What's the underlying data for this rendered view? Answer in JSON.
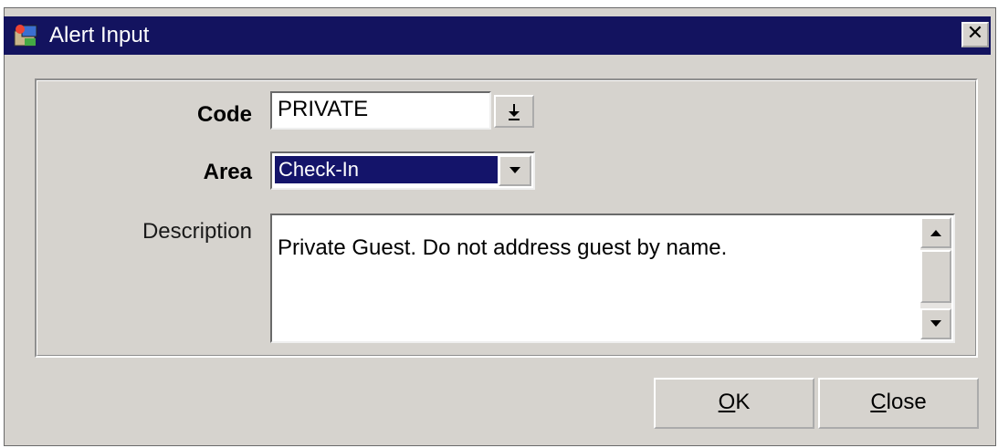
{
  "window": {
    "title": "Alert Input",
    "close_glyph": "✕",
    "icon": "app-icon"
  },
  "form": {
    "code": {
      "label": "Code",
      "value": "PRIVATE",
      "lov_icon": "down-arrow-with-bar"
    },
    "area": {
      "label": "Area",
      "value": "Check-In"
    },
    "description": {
      "label": "Description",
      "value": "Private Guest.  Do not address guest by name."
    }
  },
  "buttons": {
    "ok": {
      "mnemonic": "O",
      "rest": "K"
    },
    "close": {
      "mnemonic": "C",
      "rest": "lose"
    }
  },
  "colors": {
    "titlebar": "#13135f",
    "selection": "#14146a",
    "window_bg": "#d6d3ce"
  }
}
